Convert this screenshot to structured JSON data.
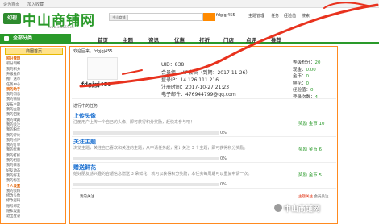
{
  "topbar": {
    "items": [
      "设为首页",
      "加入收藏"
    ]
  },
  "header": {
    "logo_badge": "幻视",
    "logo_text": "中山商铺网",
    "logo_url": "www.1uzu59.cn",
    "search_select": "中山商铺",
    "user": "fdgjgj455",
    "menu": [
      "主题管理",
      "任务",
      "经验值",
      "搜索"
    ]
  },
  "nav": {
    "all_categories": "全部分类",
    "items": [
      "首页",
      "主题",
      "资讯",
      "优惠",
      "打折",
      "门店",
      "点评",
      "推荐"
    ]
  },
  "sidebar": {
    "header": "商圈首页",
    "items": [
      {
        "label": "积分管理",
        "group": true
      },
      {
        "label": "积分明细",
        "group": false
      },
      {
        "label": "我的积分",
        "group": false
      },
      {
        "label": "升级推荐",
        "group": false
      },
      {
        "label": "推广送币",
        "group": false
      },
      {
        "label": "任务中心",
        "group": false
      },
      {
        "label": "我的助手",
        "group": true
      },
      {
        "label": "我的消息",
        "group": false
      },
      {
        "label": "我的商铺",
        "group": false
      },
      {
        "label": "发布主题",
        "group": false
      },
      {
        "label": "我的主题",
        "group": false
      },
      {
        "label": "我的回复",
        "group": false
      },
      {
        "label": "我的收藏",
        "group": false
      },
      {
        "label": "我的关注",
        "group": false
      },
      {
        "label": "我的粉丝",
        "group": false
      },
      {
        "label": "我的评论",
        "group": false
      },
      {
        "label": "我的点评",
        "group": false
      },
      {
        "label": "我的订单",
        "group": false
      },
      {
        "label": "我的优惠",
        "group": false
      },
      {
        "label": "我的打折",
        "group": false
      },
      {
        "label": "我的相册",
        "group": false
      },
      {
        "label": "我的日志",
        "group": false
      },
      {
        "label": "好友动态",
        "group": false
      },
      {
        "label": "我的好友",
        "group": false
      },
      {
        "label": "我的标签",
        "group": false
      },
      {
        "label": "个人设置",
        "group": true
      },
      {
        "label": "我的资料",
        "group": false
      },
      {
        "label": "修改头像",
        "group": false
      },
      {
        "label": "修改密码",
        "group": false
      },
      {
        "label": "账号绑定",
        "group": false
      },
      {
        "label": "隐私设置",
        "group": false
      },
      {
        "label": "退出登录",
        "group": false
      }
    ]
  },
  "profile": {
    "welcome": "欢迎回来，fdgjgj455",
    "username": "fdgjgj455",
    "uid": "UID：838",
    "group": "会员组：VIP会员（到期：2017-11-26）",
    "login_ip": "登录IP：14.126.111.216",
    "reg_time": "注册时间：2017-10-27 21:23",
    "email": "电子邮件：476944799@qq.com",
    "stats": [
      {
        "label": "等级积分：",
        "value": "20"
      },
      {
        "label": "现金：",
        "value": "0.00"
      },
      {
        "label": "金币：",
        "value": "0"
      },
      {
        "label": "鲜花：",
        "value": "0"
      },
      {
        "label": "经验值：",
        "value": "0"
      },
      {
        "label": "登录次数：",
        "value": "4"
      }
    ]
  },
  "tasks": {
    "title": "进行中的任务",
    "items": [
      {
        "title": "上传头像",
        "desc": "注册用户上传一个自己的头像，即可获得积分奖励，赶快来参与吧！",
        "reward": "奖励 金币 10",
        "progress": 0,
        "pct_label": "0%"
      },
      {
        "title": "关注主题",
        "desc": "浏览主题，关注自己喜欢和关注的主题，从申请任务起，累计关注 3 个主题，即可获得积分奖励。",
        "reward": "奖励 金币 6",
        "progress": 0,
        "pct_label": "0%"
      },
      {
        "title": "赠送鲜花",
        "desc": "给好朋友感兴趣的合适信息赠送 3 朵鲜花，就可以获得积分奖励，本任务每周期可以重复申请一次。",
        "reward": "奖励 金币 5",
        "progress": 0,
        "pct_label": "0%"
      }
    ]
  },
  "footer_row": {
    "left": "我的关注",
    "right_label": "主题关注",
    "right_value": "会员关注"
  },
  "watermark": "中山商铺网",
  "colors": {
    "brand": "#2a9a2a",
    "accent": "#ff8a1f",
    "link": "#1a6fd0",
    "scribble": "#e8321e"
  }
}
